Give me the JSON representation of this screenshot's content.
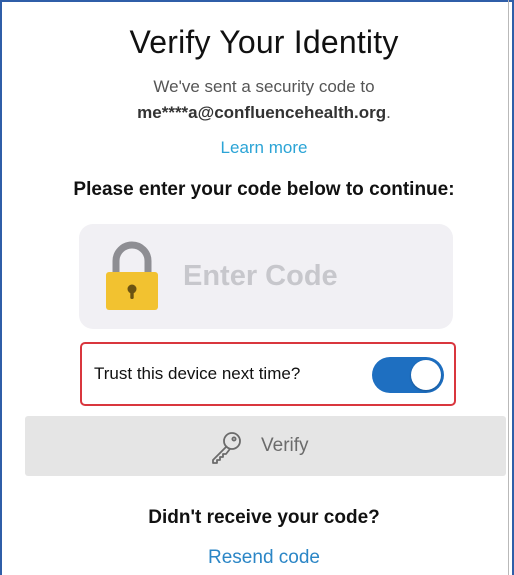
{
  "header": {
    "title": "Verify Your Identity",
    "sent_text": "We've sent a security code to",
    "email": "me****a@confluencehealth.org",
    "email_suffix": ".",
    "learn_more": "Learn more"
  },
  "form": {
    "instruction": "Please enter your code below to continue:",
    "code_placeholder": "Enter Code",
    "lock_icon": "padlock-icon",
    "trust_label": "Trust this device next time?",
    "trust_enabled": true,
    "verify_label": "Verify",
    "verify_icon": "key-icon"
  },
  "footer": {
    "didnt_receive": "Didn't receive your code?",
    "resend": "Resend code"
  },
  "colors": {
    "link": "#2ba4d6",
    "toggle_on": "#1e6fc1",
    "highlight_border": "#d9363e",
    "lock_body": "#f2c230"
  }
}
